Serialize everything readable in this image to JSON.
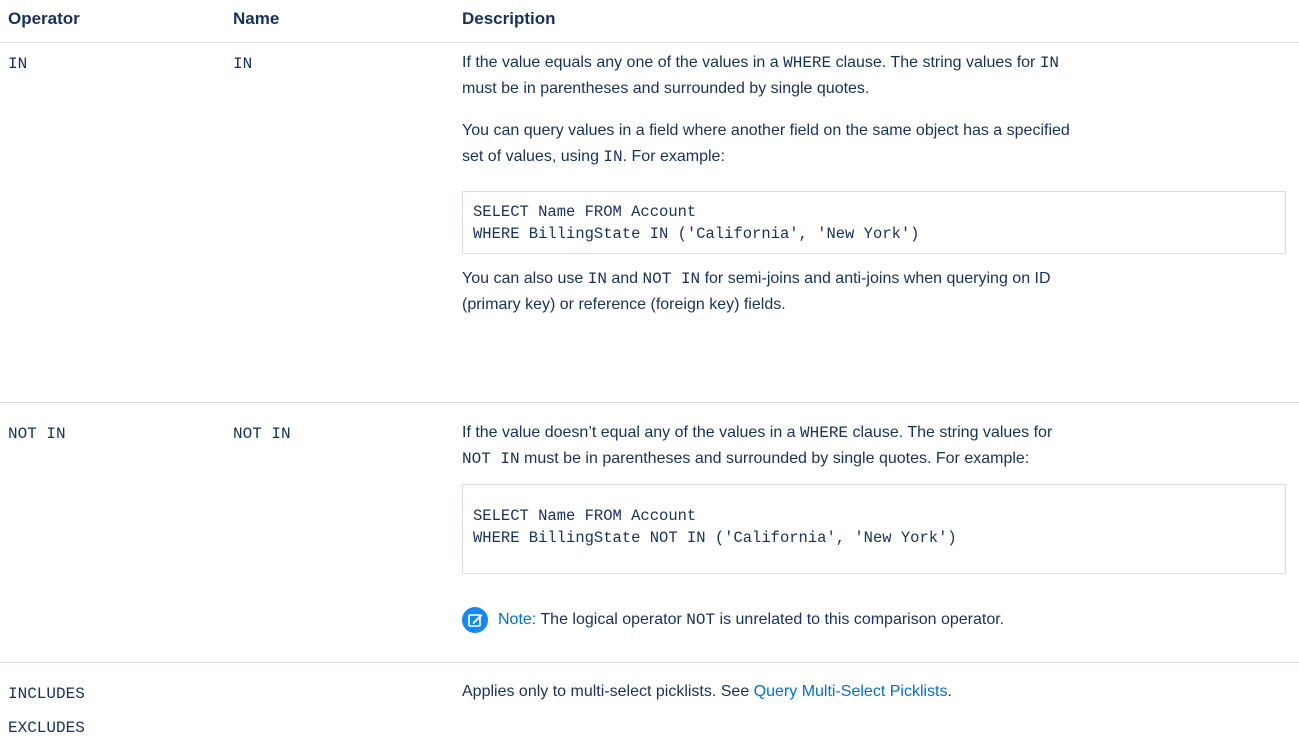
{
  "colors": {
    "text": "#16325c",
    "link": "#0070d2",
    "note_icon": "#1589ee",
    "border": "#d8dde6"
  },
  "header": {
    "operator": "Operator",
    "name": "Name",
    "description": "Description"
  },
  "row_in": {
    "operator": "IN",
    "name": "IN",
    "p1": {
      "a": "If the value equals any one of the values in a ",
      "b": "WHERE",
      "c": " clause. The string values for ",
      "d": "IN",
      "e": "must be in parentheses and surrounded by single quotes."
    },
    "p2": {
      "a": "You can query values in a field where another field on the same object has a specified",
      "b": "set of values, using ",
      "c": "IN",
      "d": ". For example:"
    },
    "code": {
      "line1": "SELECT Name FROM Account",
      "line2": "WHERE BillingState IN ('California', 'New York')"
    },
    "p3": {
      "a": "You can also use ",
      "b": "IN",
      "c": " and ",
      "d": "NOT IN",
      "e": " for semi-joins and anti-joins when querying on ID",
      "f": "(primary key) or reference (foreign key) fields."
    }
  },
  "row_not_in": {
    "operator": "NOT IN",
    "name": "NOT IN",
    "p1": {
      "a": "If the value doesn’t equal any of the values in a ",
      "b": "WHERE",
      "c": " clause. The string values for",
      "d": "NOT IN",
      "e": " must be in parentheses and surrounded by single quotes. For example:"
    },
    "code": {
      "line1": "SELECT Name FROM Account",
      "line2": "WHERE BillingState NOT IN ('California', 'New York')"
    },
    "note": {
      "icon": "edit-note-icon",
      "label": "Note:",
      "a": " The logical operator ",
      "b": "NOT",
      "c": " is unrelated to this comparison operator."
    }
  },
  "row_includes": {
    "operator_line1": "INCLUDES",
    "operator_line2": "EXCLUDES",
    "desc_a": "Applies only to multi-select picklists. See ",
    "link": "Query Multi-Select Picklists",
    "desc_b": "."
  }
}
